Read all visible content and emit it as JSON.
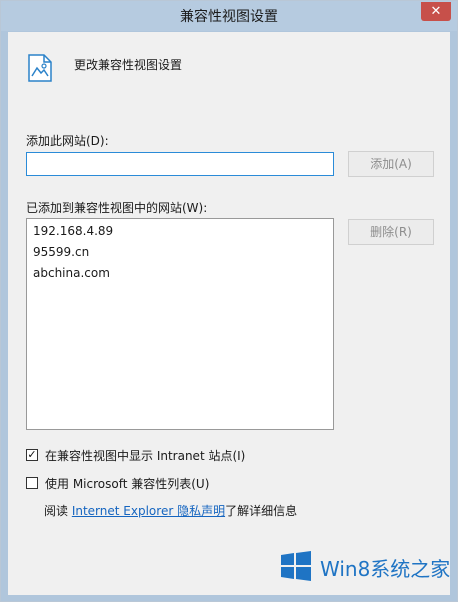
{
  "window": {
    "title": "兼容性视图设置",
    "close_glyph": "✕"
  },
  "header": {
    "icon": "document-image-icon",
    "text": "更改兼容性视图设置"
  },
  "add_site": {
    "label": "添加此网站(D):",
    "value": "",
    "add_button": "添加(A)"
  },
  "added_sites": {
    "label": "已添加到兼容性视图中的网站(W):",
    "items": [
      "192.168.4.89",
      "95599.cn",
      "abchina.com"
    ],
    "remove_button": "删除(R)"
  },
  "options": {
    "show_intranet": {
      "label": "在兼容性视图中显示 Intranet 站点(I)",
      "checked": true
    },
    "use_ms_list": {
      "label": "使用 Microsoft 兼容性列表(U)",
      "checked": false
    }
  },
  "info": {
    "prefix": "阅读 ",
    "link_text": "Internet Explorer 隐私声明",
    "suffix": "了解详细信息"
  },
  "watermark": {
    "text": "Win8系统之家"
  },
  "colors": {
    "accent": "#2a8bd8",
    "link": "#1565c0",
    "close": "#c7504a",
    "frame": "#b6cbe0"
  }
}
